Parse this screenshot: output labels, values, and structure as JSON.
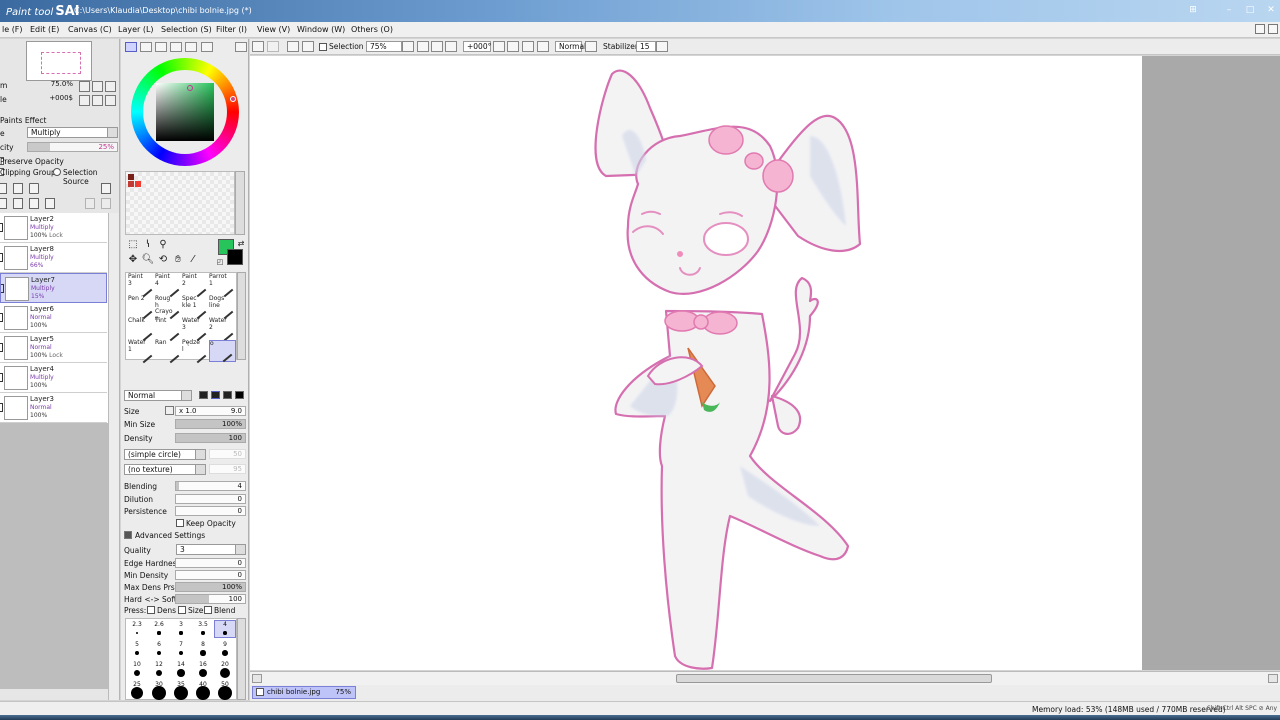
{
  "app": {
    "logo_text": "Paint tool",
    "logo_brand": "SAI",
    "window_title": "C:\\Users\\Klaudia\\Desktop\\chibi bolnie.jpg (*)"
  },
  "menu": [
    "le (F)",
    "Edit (E)",
    "Canvas (C)",
    "Layer (L)",
    "Selection (S)",
    "Filter (I)",
    "View (V)",
    "Window (W)",
    "Others (O)"
  ],
  "navigator": {
    "zoom_label": "m",
    "zoom_value": "75.0%",
    "angle_label": "le",
    "angle_value": "+000$"
  },
  "paints_effect": {
    "title": "Paints Effect",
    "mode_label": "e",
    "mode_value": "Multiply",
    "opacity_label": "city",
    "opacity_value": "25%",
    "opacity_fraction": 0.25
  },
  "layer_options": {
    "preserve_opacity": "Preserve Opacity",
    "clipping_group": "Clipping Group",
    "selection_source": "Selection Source"
  },
  "layers": [
    {
      "name": "Layer2",
      "mode": "Multiply",
      "opacity": "100%",
      "lock": "Lock",
      "active": false,
      "purple": false
    },
    {
      "name": "Layer8",
      "mode": "Multiply",
      "opacity": "66%",
      "lock": "",
      "active": false,
      "purple": true
    },
    {
      "name": "Layer7",
      "mode": "Multiply",
      "opacity": "15%",
      "lock": "",
      "active": true,
      "purple": true
    },
    {
      "name": "Layer6",
      "mode": "Normal",
      "opacity": "100%",
      "lock": "",
      "active": false,
      "purple": false
    },
    {
      "name": "Layer5",
      "mode": "Normal",
      "opacity": "100%",
      "lock": "Lock",
      "active": false,
      "purple": false
    },
    {
      "name": "Layer4",
      "mode": "Multiply",
      "opacity": "100%",
      "lock": "",
      "active": false,
      "purple": false
    },
    {
      "name": "Layer3",
      "mode": "Normal",
      "opacity": "100%",
      "lock": "",
      "active": false,
      "purple": false
    }
  ],
  "colors": {
    "foreground": "#27c45b",
    "background": "#000000",
    "accent": "#d6d8f6",
    "selection_border": "#7b7fd6",
    "lineart": "#d56fb0"
  },
  "brush_tools": [
    [
      "Paint 3",
      "Paint 4",
      "Paint 2",
      "Parrot 1"
    ],
    [
      "Pen 2",
      "Rough Crayon",
      "Speckle 1",
      "Dogs line"
    ],
    [
      "Chalk",
      "Tint",
      "Water 3",
      "Water 2"
    ],
    [
      "Water 1",
      "Ran",
      "Pędzel",
      "o"
    ]
  ],
  "brush_settings": {
    "mode": "Normal",
    "size_label": "Size",
    "size_mult": "x 1.0",
    "size_value": "9.0",
    "min_size_label": "Min Size",
    "min_size_value": "100%",
    "density_label": "Density",
    "density_value": "100",
    "shape": "(simple circle)",
    "shape_value": "50",
    "texture": "(no texture)",
    "texture_value": "95",
    "blending_label": "Blending",
    "blending_value": "4",
    "dilution_label": "Dilution",
    "dilution_value": "0",
    "persistence_label": "Persistence",
    "persistence_value": "0",
    "keep_opacity": "Keep Opacity",
    "advanced_title": "Advanced Settings",
    "quality_label": "Quality",
    "quality_value": "3",
    "edge_hardness_label": "Edge Hardness",
    "edge_hardness_value": "0",
    "min_density_label": "Min Density",
    "min_density_value": "0",
    "max_dens_prs_label": "Max Dens Prs.",
    "max_dens_prs_value": "100%",
    "hard_soft_label": "Hard <-> Soft",
    "hard_soft_value": "100",
    "press_label": "Press:",
    "press_dens": "Dens",
    "press_size": "Size",
    "press_blend": "Blend"
  },
  "brush_sizes": [
    "2.3",
    "2.6",
    "3",
    "3.5",
    "4",
    "5",
    "6",
    "7",
    "8",
    "9",
    "10",
    "12",
    "14",
    "16",
    "20",
    "25",
    "30",
    "35",
    "40",
    "50"
  ],
  "toolbar": {
    "selection_label": "Selection",
    "zoom": "75%",
    "angle": "+000°",
    "blend": "Normal",
    "stabilizer_label": "Stabilizer",
    "stabilizer_value": "15"
  },
  "file_tab": {
    "name": "chibi bolnie.jpg",
    "zoom": "75%"
  },
  "status": {
    "memory": "Memory load: 53% (148MB used / 770MB reserved)",
    "keys": "Shift Ctrl Alt SPC ⊘ Any"
  }
}
